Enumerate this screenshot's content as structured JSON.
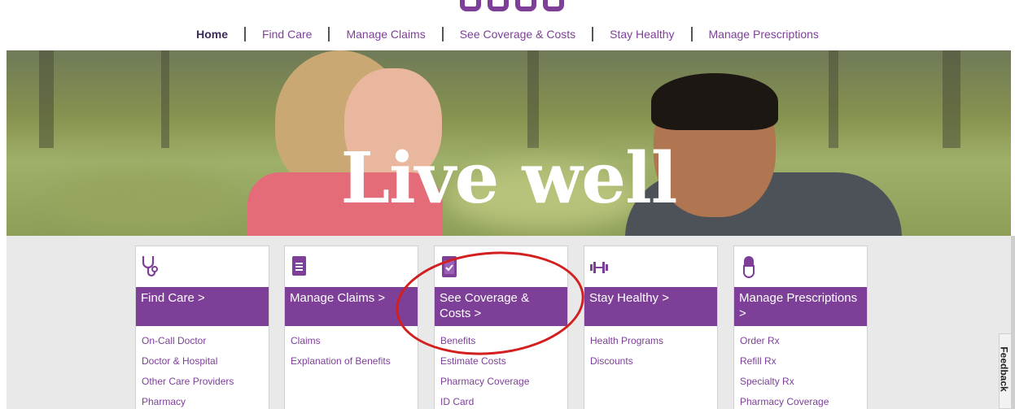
{
  "nav": {
    "items": [
      "Home",
      "Find Care",
      "Manage Claims",
      "See Coverage & Costs",
      "Stay Healthy",
      "Manage Prescriptions"
    ]
  },
  "hero": {
    "title": "Live well"
  },
  "cards": [
    {
      "title": "Find Care >",
      "icon": "stethoscope-icon",
      "links": [
        "On-Call Doctor",
        "Doctor & Hospital",
        "Other Care Providers",
        "Pharmacy"
      ]
    },
    {
      "title": "Manage Claims >",
      "icon": "document-icon",
      "links": [
        "Claims",
        "Explanation of Benefits"
      ]
    },
    {
      "title": "See Coverage & Costs >",
      "icon": "clipboard-check-icon",
      "links": [
        "Benefits",
        "Estimate Costs",
        "Pharmacy Coverage",
        "ID Card"
      ]
    },
    {
      "title": "Stay Healthy >",
      "icon": "dumbbell-icon",
      "links": [
        "Health Programs",
        "Discounts"
      ]
    },
    {
      "title": "Manage Prescriptions >",
      "icon": "pill-icon",
      "links": [
        "Order Rx",
        "Refill Rx",
        "Specialty Rx",
        "Pharmacy Coverage"
      ]
    }
  ],
  "feedback": {
    "label": "Feedback"
  },
  "colors": {
    "brand": "#7d3f98",
    "annotation": "#d21f1f",
    "panel": "#e9e9e9"
  }
}
